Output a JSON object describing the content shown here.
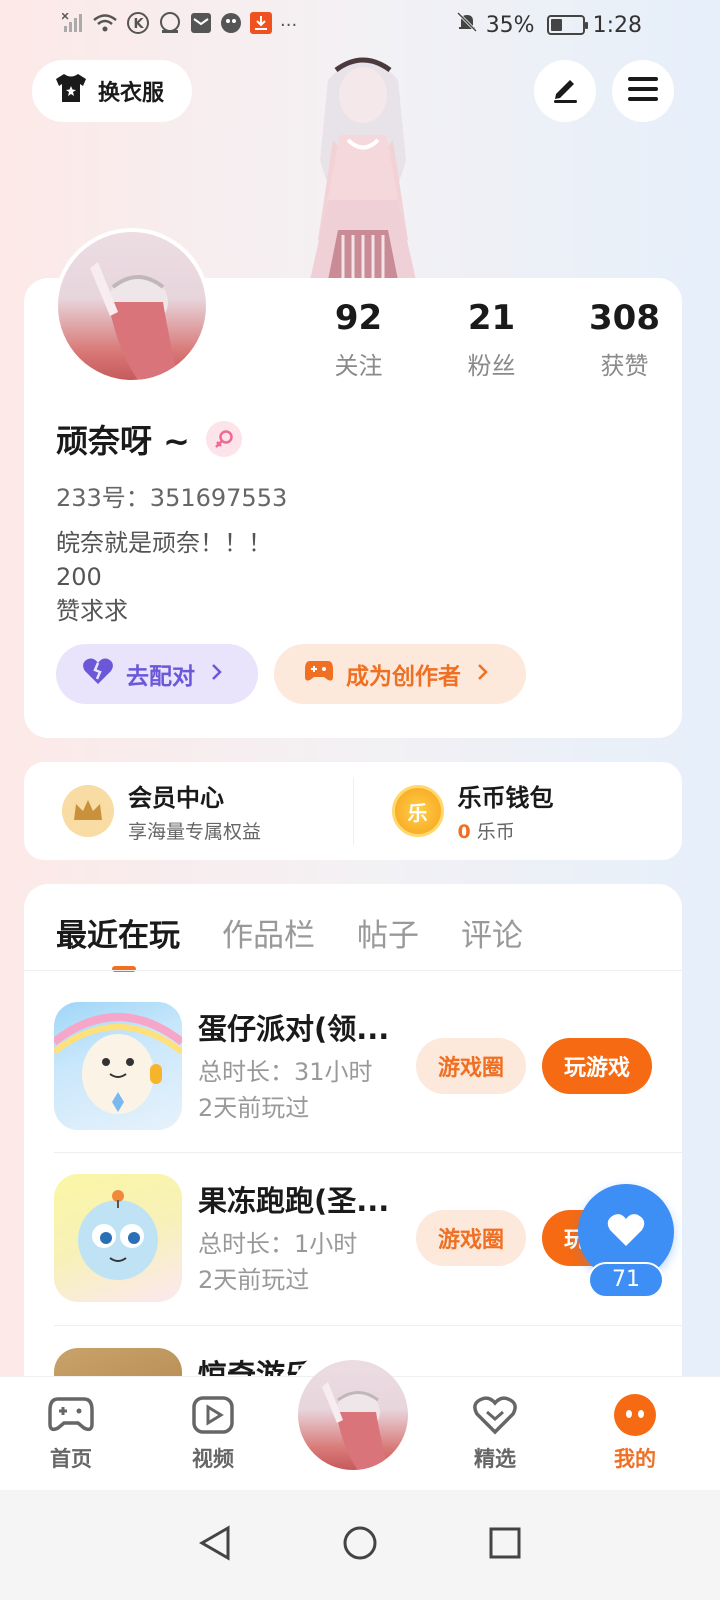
{
  "status_bar": {
    "battery": "35%",
    "time": "1:28",
    "more": "···"
  },
  "header": {
    "dress_label": "换衣服"
  },
  "profile": {
    "stats": [
      {
        "value": "92",
        "label": "关注"
      },
      {
        "value": "21",
        "label": "粉丝"
      },
      {
        "value": "308",
        "label": "获赞"
      }
    ],
    "username": "顽奈呀 ~",
    "user_id": "233号：351697553",
    "bio_lines": [
      "皖奈就是顽奈！！！",
      "200",
      "赞求求"
    ],
    "pair_label": "去配对",
    "creator_label": "成为创作者"
  },
  "wallet": {
    "vip_title": "会员中心",
    "vip_sub": "享海量专属权益",
    "coin_title": "乐币钱包",
    "coin_icon_char": "乐",
    "coin_count": "0",
    "coin_unit": "乐币"
  },
  "tabs": [
    "最近在玩",
    "作品栏",
    "帖子",
    "评论"
  ],
  "games": [
    {
      "title": "蛋仔派对(领...",
      "duration": "总时长：31小时",
      "last_played": "2天前玩过",
      "circle_label": "游戏圈",
      "play_label": "玩游戏"
    },
    {
      "title": "果冻跑跑(圣...",
      "duration": "总时长：1小时",
      "last_played": "2天前玩过",
      "circle_label": "游戏圈",
      "play_label": "玩游戏"
    },
    {
      "title": "惊奇游乐..."
    }
  ],
  "like_float": {
    "count": "71"
  },
  "bottom_nav": {
    "home": "首页",
    "video": "视频",
    "featured": "精选",
    "mine": "我的"
  },
  "colors": {
    "accent": "#f07023",
    "pair": "#6b58d8",
    "like": "#3d8ef5"
  }
}
